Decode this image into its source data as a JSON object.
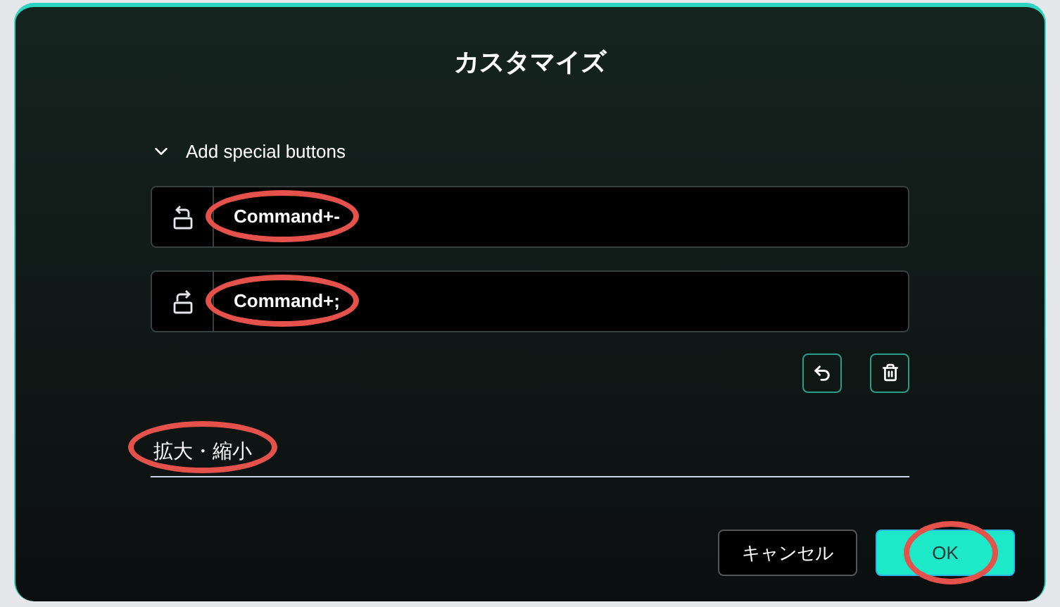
{
  "dialog": {
    "title": "カスタマイズ"
  },
  "section": {
    "label": "Add special buttons",
    "expanded": true
  },
  "shortcuts": [
    {
      "kind": "undo",
      "keys": "Command+-",
      "highlighted": true
    },
    {
      "kind": "redo",
      "keys": "Command+;",
      "highlighted": true
    }
  ],
  "name_field": {
    "value": "拡大・縮小",
    "highlighted": true
  },
  "buttons": [
    {
      "kind": "secondary",
      "label": "キャンセル",
      "highlighted": false
    },
    {
      "kind": "primary",
      "label": "OK",
      "highlighted": true
    }
  ]
}
